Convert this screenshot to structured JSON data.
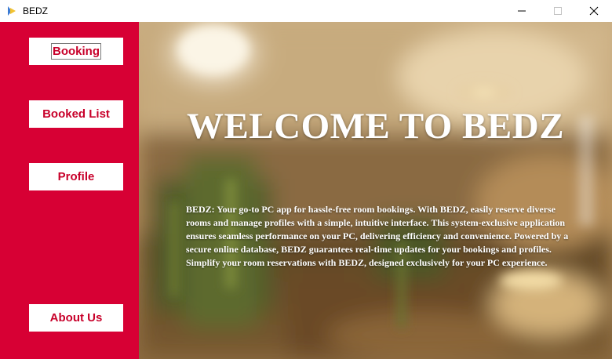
{
  "window": {
    "title": "BEDZ",
    "icon": "app-logo-icon",
    "controls": [
      "minimize-icon",
      "maximize-icon",
      "close-icon"
    ]
  },
  "sidebar": {
    "color": "#d70034",
    "buttons": [
      {
        "label": "Booking",
        "focused": true
      },
      {
        "label": "Booked List"
      },
      {
        "label": "Profile"
      },
      {
        "label": "About Us"
      }
    ]
  },
  "hero": {
    "title": "WELCOME TO BEDZ",
    "description": "BEDZ: Your go-to PC app for hassle-free room bookings. With BEDZ, easily reserve diverse rooms and manage profiles with a simple, intuitive interface. This system-exclusive application ensures seamless performance on your PC, delivering efficiency and convenience. Powered by a secure online database, BEDZ guarantees real-time updates for your bookings and profiles. Simplify your room reservations with BEDZ, designed exclusively for your PC experience."
  },
  "colors": {
    "accent": "#d70034",
    "button_text": "#c8002a"
  }
}
